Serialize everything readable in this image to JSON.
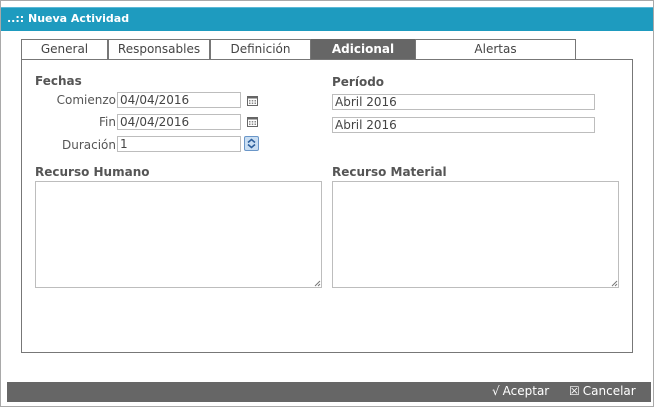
{
  "window": {
    "title": "..:: Nueva Actividad"
  },
  "tabs": [
    {
      "label": "General",
      "active": false
    },
    {
      "label": "Responsables",
      "active": false
    },
    {
      "label": "Definición",
      "active": false
    },
    {
      "label": "Adicional",
      "active": true
    },
    {
      "label": "Alertas",
      "active": false
    }
  ],
  "fechas": {
    "heading": "Fechas",
    "comienzo_label": "Comienzo",
    "comienzo_value": "04/04/2016",
    "fin_label": "Fin",
    "fin_value": "04/04/2016",
    "duracion_label": "Duración",
    "duracion_value": "1"
  },
  "periodo": {
    "heading": "Período",
    "value1": "Abril 2016",
    "value2": "Abril 2016"
  },
  "recurso_humano": {
    "heading": "Recurso Humano",
    "value": ""
  },
  "recurso_material": {
    "heading": "Recurso Material",
    "value": ""
  },
  "footer": {
    "accept_icon": "√",
    "accept_label": "Aceptar",
    "cancel_icon": "☒",
    "cancel_label": "Cancelar"
  },
  "colors": {
    "titlebar": "#1e9bbf",
    "active_tab": "#666666",
    "footer": "#666666"
  }
}
